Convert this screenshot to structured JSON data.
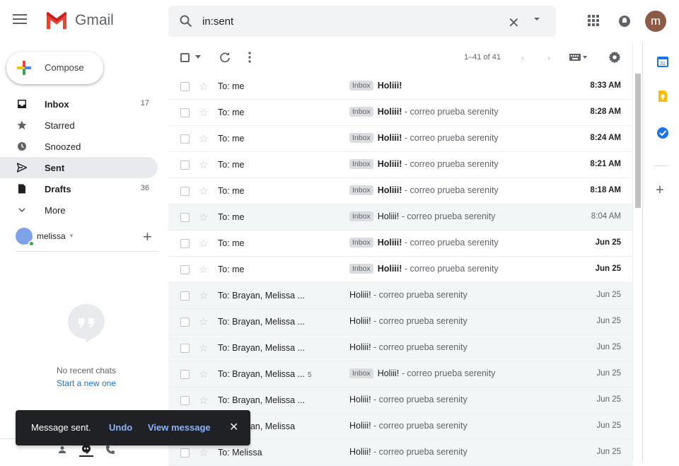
{
  "header": {
    "logo_text": "Gmail",
    "search_value": "in:sent",
    "avatar_letter": "m"
  },
  "sidebar": {
    "compose_label": "Compose",
    "items": [
      {
        "label": "Inbox",
        "count": "17",
        "bold": true,
        "icon": "inbox-icon"
      },
      {
        "label": "Starred",
        "count": "",
        "bold": false,
        "icon": "star-icon"
      },
      {
        "label": "Snoozed",
        "count": "",
        "bold": false,
        "icon": "clock-icon"
      },
      {
        "label": "Sent",
        "count": "",
        "bold": true,
        "icon": "send-icon",
        "active": true
      },
      {
        "label": "Drafts",
        "count": "36",
        "bold": true,
        "icon": "draft-icon"
      },
      {
        "label": "More",
        "count": "",
        "bold": false,
        "icon": "chevron-down-icon"
      }
    ],
    "hangouts_user": "melissa",
    "no_chats": "No recent chats",
    "start_new": "Start a new one"
  },
  "toolbar": {
    "count": "1–41 of 41"
  },
  "emails": [
    {
      "to": "To: me",
      "count": "",
      "inbox": true,
      "subject": "Holiii!",
      "snippet": "",
      "date": "8:33 AM",
      "unread": true
    },
    {
      "to": "To: me",
      "count": "",
      "inbox": true,
      "subject": "Holiii!",
      "snippet": " - correo prueba serenity",
      "date": "8:28 AM",
      "unread": true
    },
    {
      "to": "To: me",
      "count": "",
      "inbox": true,
      "subject": "Holiii!",
      "snippet": " - correo prueba serenity",
      "date": "8:24 AM",
      "unread": true
    },
    {
      "to": "To: me",
      "count": "",
      "inbox": true,
      "subject": "Holiii!",
      "snippet": " - correo prueba serenity",
      "date": "8:21 AM",
      "unread": true
    },
    {
      "to": "To: me",
      "count": "",
      "inbox": true,
      "subject": "Holiii!",
      "snippet": " - correo prueba serenity",
      "date": "8:18 AM",
      "unread": true
    },
    {
      "to": "To: me",
      "count": "",
      "inbox": true,
      "subject": "Holiii!",
      "snippet": " - correo prueba serenity",
      "date": "8:04 AM",
      "unread": false
    },
    {
      "to": "To: me",
      "count": "",
      "inbox": true,
      "subject": "Holiii!",
      "snippet": " - correo prueba serenity",
      "date": "Jun 25",
      "unread": true
    },
    {
      "to": "To: me",
      "count": "",
      "inbox": true,
      "subject": "Holiii!",
      "snippet": " - correo prueba serenity",
      "date": "Jun 25",
      "unread": true
    },
    {
      "to": "To: Brayan, Melissa ...",
      "count": "",
      "inbox": false,
      "subject": "Holiii!",
      "snippet": " - correo prueba serenity",
      "date": "Jun 25",
      "unread": false
    },
    {
      "to": "To: Brayan, Melissa ...",
      "count": "",
      "inbox": false,
      "subject": "Holiii!",
      "snippet": " - correo prueba serenity",
      "date": "Jun 25",
      "unread": false
    },
    {
      "to": "To: Brayan, Melissa ...",
      "count": "",
      "inbox": false,
      "subject": "Holiii!",
      "snippet": " - correo prueba serenity",
      "date": "Jun 25",
      "unread": false
    },
    {
      "to": "To: Brayan, Melissa ...",
      "count": "5",
      "inbox": true,
      "subject": "Holiii!",
      "snippet": " - correo prueba serenity",
      "date": "Jun 25",
      "unread": false
    },
    {
      "to": "To: Brayan, Melissa ...",
      "count": "",
      "inbox": false,
      "subject": "Holiii!",
      "snippet": " - correo prueba serenity",
      "date": "Jun 25",
      "unread": false
    },
    {
      "to": "To: Brayan, Melissa",
      "count": "",
      "inbox": false,
      "subject": "Holiii!",
      "snippet": " - correo prueba serenity",
      "date": "Jun 25",
      "unread": false
    },
    {
      "to": "To: Melissa",
      "count": "",
      "inbox": false,
      "subject": "Holiii!",
      "snippet": " - correo prueba serenity",
      "date": "Jun 25",
      "unread": false
    }
  ],
  "inbox_tag": "Inbox",
  "snackbar": {
    "message": "Message sent.",
    "undo": "Undo",
    "view": "View message"
  }
}
